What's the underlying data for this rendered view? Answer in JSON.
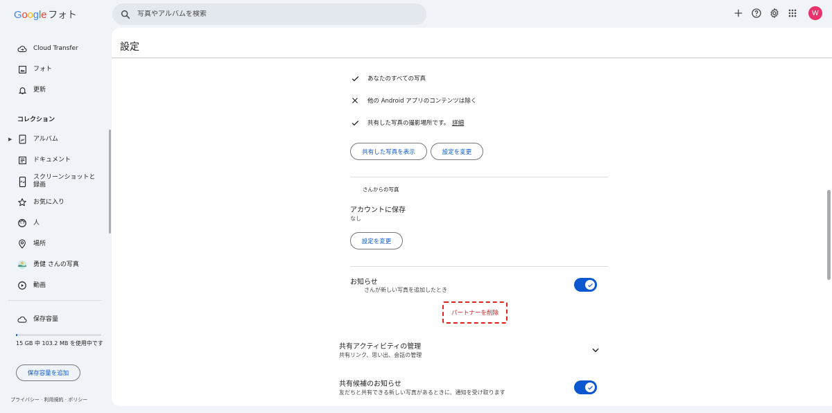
{
  "app": {
    "logo_brand": "Google",
    "logo_product": "フォト",
    "avatar_letter": "W"
  },
  "search": {
    "placeholder": "写真やアルバムを検索"
  },
  "sidebar": {
    "items": [
      {
        "label": "Cloud Transfer",
        "icon": "cloud-transfer-icon"
      },
      {
        "label": "フォト",
        "icon": "photo-icon"
      },
      {
        "label": "更新",
        "icon": "bell-icon"
      }
    ],
    "collection_heading": "コレクション",
    "collection_items": [
      {
        "label": "アルバム",
        "icon": "album-icon"
      },
      {
        "label": "ドキュメント",
        "icon": "document-icon"
      },
      {
        "label": "スクリーンショットと\n録画",
        "icon": "screenshot-icon"
      },
      {
        "label": "お気に入り",
        "icon": "star-icon"
      },
      {
        "label": "人",
        "icon": "face-icon"
      },
      {
        "label": "場所",
        "icon": "location-icon"
      },
      {
        "label": "勇健 さんの写真",
        "icon": "partner-avatar-icon"
      },
      {
        "label": "動画",
        "icon": "video-icon"
      }
    ],
    "storage": {
      "label": "保存容量",
      "usage_text": "15 GB 中 103.2 MB を使用中です",
      "used_fraction": 0.007,
      "add_button": "保存容量を追加"
    },
    "footer": "プライバシー · 利用規約 · ポリシー"
  },
  "main": {
    "title": "設定",
    "share_rows": [
      {
        "mark": "check",
        "text": "あなたのすべての写真"
      },
      {
        "mark": "x",
        "text": "他の Android アプリのコンテンツは除く"
      },
      {
        "mark": "check",
        "text": "共有した写真の撮影場所です。",
        "link": "詳細"
      }
    ],
    "show_shared_button": "共有した写真を表示",
    "change_settings_button": "設定を変更",
    "from_partner_label": "さんからの写真",
    "save_to_account": {
      "label": "アカウントに保存",
      "value": "なし"
    },
    "change_settings_button_2": "設定を変更",
    "notification": {
      "label": "お知らせ",
      "sub": "さんが新しい写真を追加したとき",
      "enabled": true
    },
    "remove_partner_button": "パートナーを削除",
    "sharing_activity": {
      "label": "共有アクティビティの管理",
      "sub": "共有リンク、思い出、会話の管理"
    },
    "sharing_suggestions": {
      "label": "共有候補のお知らせ",
      "sub": "友だちと共有できる新しい写真があるときに、通知を受け取ります",
      "enabled": true
    }
  },
  "colors": {
    "accent": "#0b57d0",
    "danger": "#e0201b",
    "bg": "#f0f4f9",
    "avatar": "#e8336a"
  }
}
